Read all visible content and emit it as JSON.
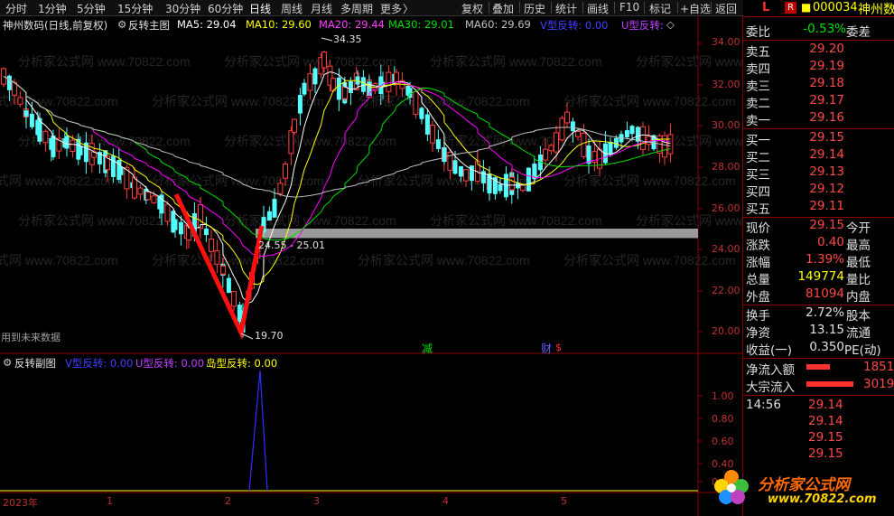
{
  "toolbar": {
    "items": [
      "分时",
      "1分钟",
      "5分钟",
      "15分钟",
      "30分钟",
      "60分钟",
      "日线",
      "周线",
      "月线",
      "多周期",
      "更多",
      "复权",
      "叠加",
      "历史",
      "统计",
      "画线",
      "F10",
      "标记",
      "+自选",
      "返回"
    ],
    "active_index": 6,
    "more_arrow": "〉"
  },
  "main_header": {
    "stock": "神州数码(日线,前复权)",
    "indicator": "反转主图",
    "ma5": "MA5: 29.04",
    "ma10": "MA10: 29.60",
    "ma20": "MA20: 29.44",
    "ma30": "MA30: 29.01",
    "ma60": "MA60: 29.69",
    "v_label": "V型反转: 0.00",
    "u_label": "U型反转:"
  },
  "sub_header": {
    "indicator": "反转副图",
    "v_label": "V型反转: 0.00",
    "u_label": "U型反转: 0.00",
    "island": "岛型反转: 0.00"
  },
  "annotations": {
    "high": "34.35",
    "low": "19.70",
    "gap": "24.55 - 25.01",
    "future": "用到未来数据",
    "jian": "减",
    "cai": "财",
    "dot": "$"
  },
  "y_axis": [
    "34.00",
    "32.00",
    "30.00",
    "28.00",
    "26.00",
    "24.00",
    "22.00",
    "20.00"
  ],
  "sub_y_axis": [
    "1.00",
    "0.80",
    "0.60",
    "0.40",
    "0.20"
  ],
  "x_axis": {
    "year": "2023年",
    "m1": "1",
    "m2": "2",
    "m3": "3",
    "m4": "4",
    "m5": "5"
  },
  "watermark": "分析家公式网 www.70822.com",
  "right_panel": {
    "tag_l": "L",
    "tag_r": "R",
    "code": "000034",
    "name": "神州数码",
    "weibi_label": "委比",
    "weibi_val": "-0.53%",
    "weicha_label": "委差",
    "sell": [
      {
        "label": "卖五",
        "price": "29.20"
      },
      {
        "label": "卖四",
        "price": "29.19"
      },
      {
        "label": "卖三",
        "price": "29.18"
      },
      {
        "label": "卖二",
        "price": "29.17"
      },
      {
        "label": "卖一",
        "price": "29.16"
      }
    ],
    "buy": [
      {
        "label": "买一",
        "price": "29.15"
      },
      {
        "label": "买二",
        "price": "29.14"
      },
      {
        "label": "买三",
        "price": "29.13"
      },
      {
        "label": "买四",
        "price": "29.12"
      },
      {
        "label": "买五",
        "price": "29.11"
      }
    ],
    "stats": [
      {
        "l": "现价",
        "v": "29.15",
        "r": "今开"
      },
      {
        "l": "涨跌",
        "v": "0.40",
        "r": "最高"
      },
      {
        "l": "涨幅",
        "v": "1.39%",
        "r": "最低"
      },
      {
        "l": "总量",
        "v": "149774",
        "r": "量比"
      },
      {
        "l": "外盘",
        "v": "81094",
        "r": "内盘"
      }
    ],
    "stats2": [
      {
        "l": "换手",
        "v": "2.72%",
        "r": "股本"
      },
      {
        "l": "净资",
        "v": "13.15",
        "r": "流通"
      },
      {
        "l": "收益(一)",
        "v": "0.350",
        "r": "PE(动)"
      }
    ],
    "flow": [
      {
        "l": "净流入额",
        "v": "1851"
      },
      {
        "l": "大宗流入",
        "v": "3019"
      }
    ],
    "tick_time": "14:56",
    "ticks": [
      "29.14",
      "29.14",
      "29.15",
      "29.15"
    ],
    "logo_text": "分析家公式网",
    "logo_url": "www.70822.com"
  },
  "colors": {
    "up": "#ff3c3c",
    "down": "#54ffff",
    "ma5": "#ffffff",
    "ma10": "#ffff00",
    "ma20": "#ff00ff",
    "ma30": "#00e000",
    "ma60": "#c0c0c0"
  }
}
